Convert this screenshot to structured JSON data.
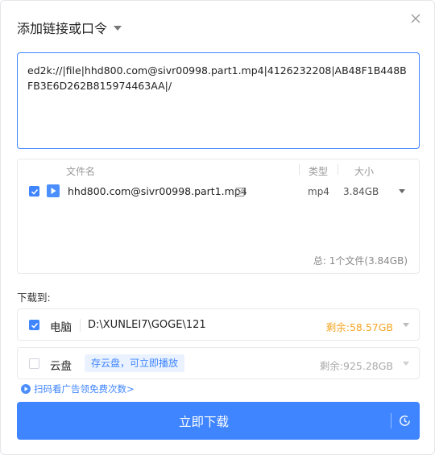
{
  "dialog": {
    "title": "添加链接或口令"
  },
  "link_input": {
    "value": "ed2k://|file|hhd800.com@sivr00998.part1.mp4|4126232208|AB48F1B448BFB3E6D262B815974463AA|/"
  },
  "file_list": {
    "columns": {
      "name": "文件名",
      "type": "类型",
      "size": "大小"
    },
    "files": [
      {
        "name": "hhd800.com@sivr00998.part1.mp4",
        "type": "mp4",
        "size": "3.84GB",
        "checked": true
      }
    ],
    "total": "总:  1个文件(3.84GB)"
  },
  "download_to": {
    "label": "下载到:",
    "pc": {
      "name": "电脑",
      "path": "D:\\XUNLEI7\\GOGE\\121",
      "remaining": "剩余:58.57GB",
      "checked": true
    },
    "cloud": {
      "name": "云盘",
      "tag": "存云盘，可立即播放",
      "remaining": "剩余:925.28GB",
      "checked": false
    }
  },
  "ad_link": "扫码看广告领免费次数>",
  "download_button": "立即下载",
  "colors": {
    "accent": "#3f85ff",
    "remaining_pc": "#f5a623",
    "remaining_cloud": "#aaaaaa"
  },
  "icons": [
    "close-icon",
    "chevron-down-icon",
    "play-icon",
    "edit-icon",
    "checkbox-icon",
    "clock-icon",
    "ad-icon"
  ]
}
